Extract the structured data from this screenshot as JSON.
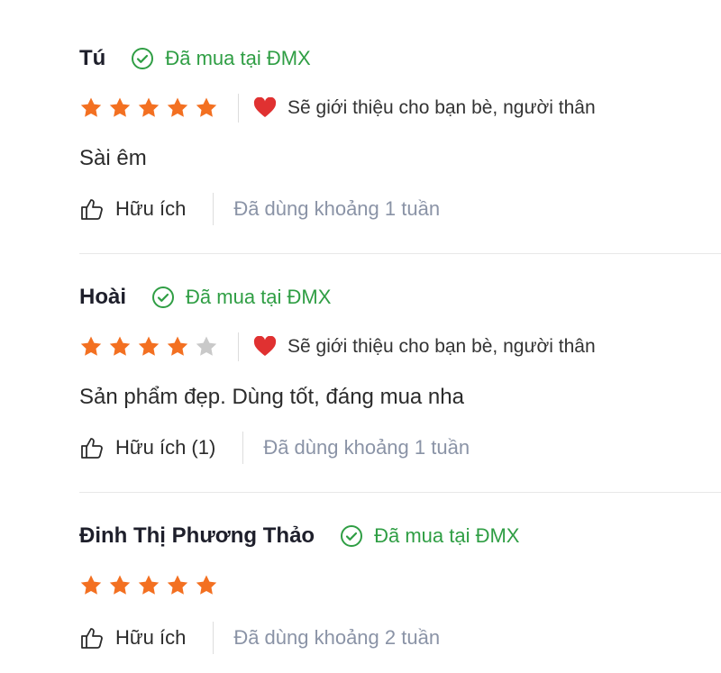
{
  "colors": {
    "star_filled": "#f37021",
    "star_empty": "#c9c9c9",
    "verified": "#2f9e44",
    "heart": "#e03131",
    "muted": "#8a93a6"
  },
  "icons": {
    "verified": "check-circle-icon",
    "star": "star-icon",
    "recommend": "heart-icon",
    "helpful": "thumbs-up-icon"
  },
  "reviews": [
    {
      "name": "Tú",
      "verified": "Đã mua tại ĐMX",
      "rating": 5,
      "recommend": "Sẽ giới thiệu cho bạn bè, người thân",
      "content": "Sài êm",
      "helpful": "Hữu ích",
      "used": "Đã dùng khoảng 1 tuần"
    },
    {
      "name": "Hoài",
      "verified": "Đã mua tại ĐMX",
      "rating": 4,
      "recommend": "Sẽ giới thiệu cho bạn bè, người thân",
      "content": "Sản phẩm đẹp. Dùng tốt, đáng mua nha",
      "helpful": "Hữu ích (1)",
      "used": "Đã dùng khoảng 1 tuần"
    },
    {
      "name": "Đinh Thị Phương Thảo",
      "verified": "Đã mua tại ĐMX",
      "rating": 5,
      "helpful": "Hữu ích",
      "used": "Đã dùng khoảng 2 tuần"
    }
  ]
}
